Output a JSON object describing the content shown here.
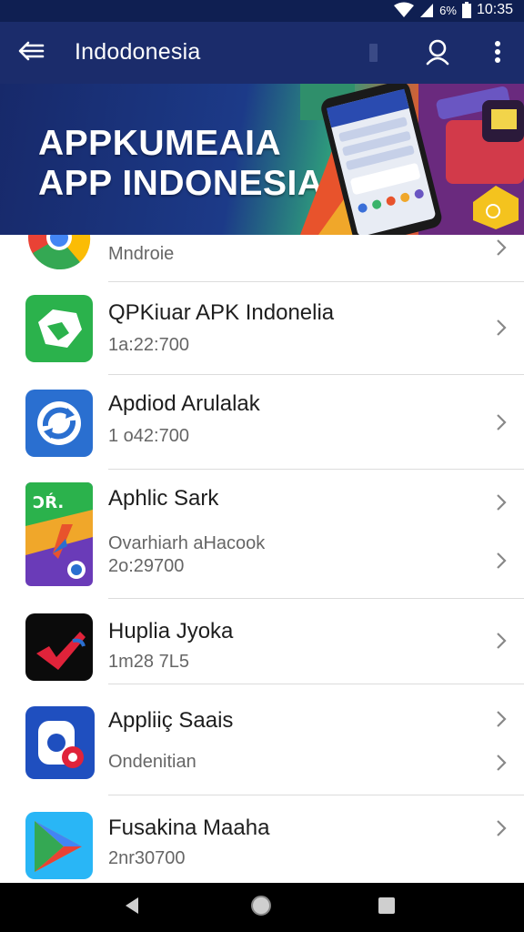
{
  "status_bar": {
    "battery_text": "6%",
    "time": "10:35"
  },
  "app_bar": {
    "title": "Indodonesia"
  },
  "banner": {
    "line1": "APPKUMEAIA",
    "line2": "APP INDONESIA"
  },
  "list": {
    "items": [
      {
        "title": "",
        "subtitle": "Mndroie",
        "meta": ""
      },
      {
        "title": "QPKiuar APK Indonelia",
        "subtitle": "1a:22:700",
        "meta": ""
      },
      {
        "title": "Apdiod Arulalak",
        "subtitle": "1 o42:700",
        "meta": ""
      },
      {
        "title": "Aphlic Sark",
        "subtitle": "Ovarhiarh aHacook",
        "meta": "2o:29700"
      },
      {
        "title": "Huplia Jyoka",
        "subtitle": "1m28 7L5",
        "meta": ""
      },
      {
        "title": "Appliiç Saais",
        "subtitle": "Ondenitian",
        "meta": ""
      },
      {
        "title": "Fusakina Maaha",
        "subtitle": "2nr30700",
        "meta": ""
      }
    ]
  },
  "colors": {
    "status_bar": "#0f1f52",
    "app_bar": "#1b2c6b",
    "nav_bar": "#000000"
  },
  "icons": [
    "back-arrow-icon",
    "search-icon",
    "more-vert-icon",
    "chevron-right-icon",
    "nav-back-icon",
    "nav-home-icon",
    "nav-recents-icon"
  ]
}
